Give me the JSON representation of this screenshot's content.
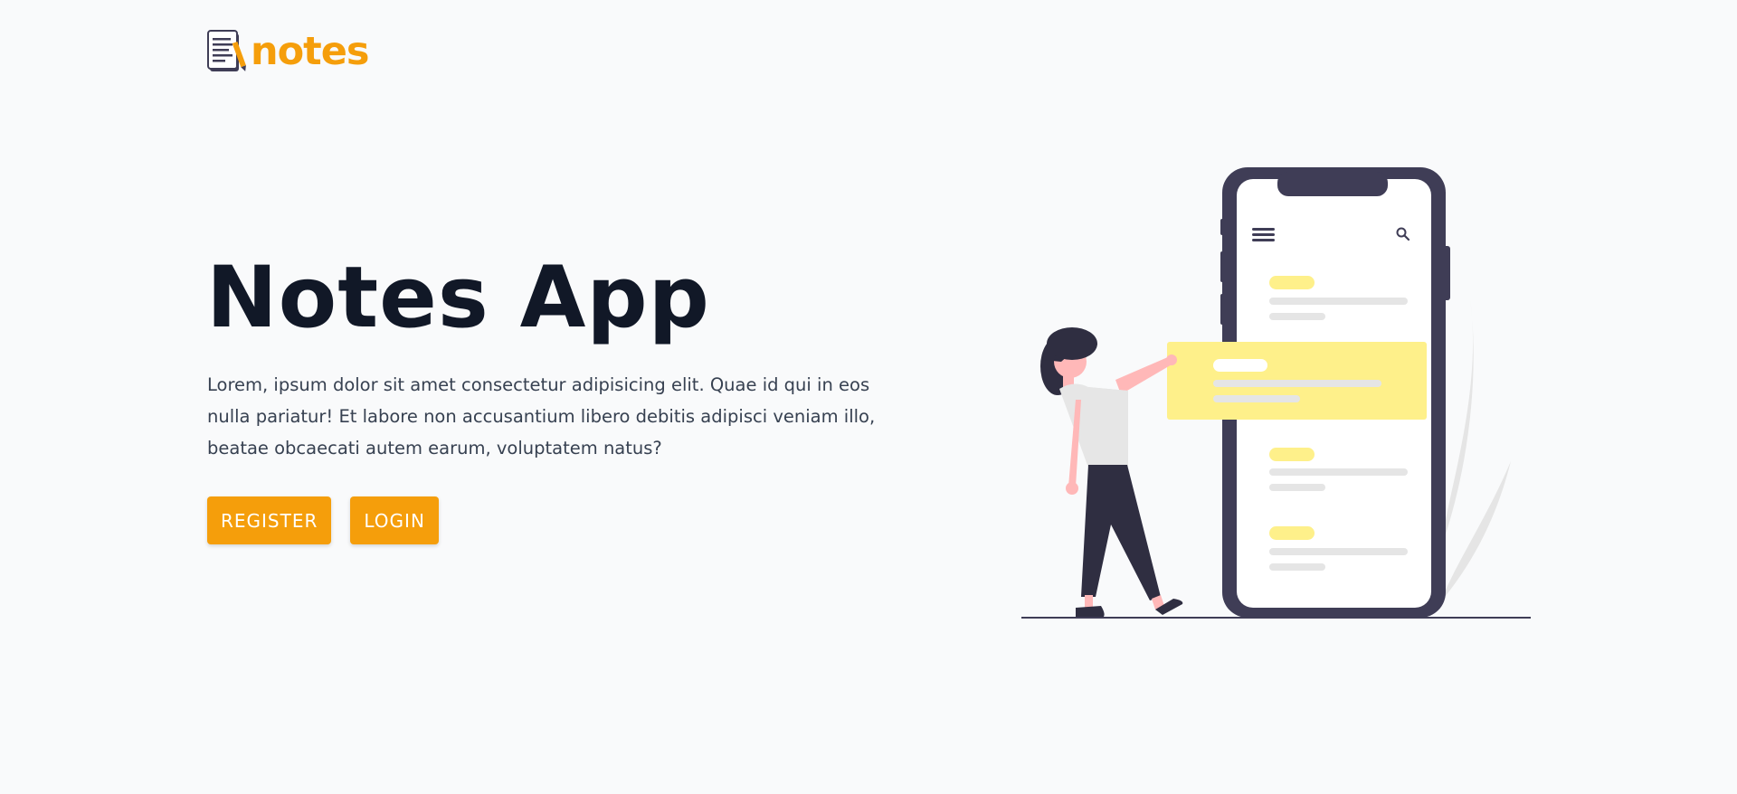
{
  "header": {
    "logo_text": "notes",
    "logo_icon": "notepad-pencil-icon"
  },
  "hero": {
    "title": "Notes App",
    "description": "Lorem, ipsum dolor sit amet consectetur adipisicing elit. Quae id qui in eos nulla pariatur! Et labore non accusantium libero debitis adipisci veniam illo, beatae obcaecati autem earum, voluptatem natus?",
    "register_label": "REGISTER",
    "login_label": "LOGIN"
  },
  "illustration": {
    "phone_menu_icon": "hamburger-menu-icon",
    "phone_search_icon": "search-icon"
  },
  "colors": {
    "accent": "#f59e0b",
    "title": "#111827",
    "text": "#374151",
    "background": "#f9fafb",
    "phone_frame": "#3f3d56",
    "note_highlight": "#fef08a"
  }
}
